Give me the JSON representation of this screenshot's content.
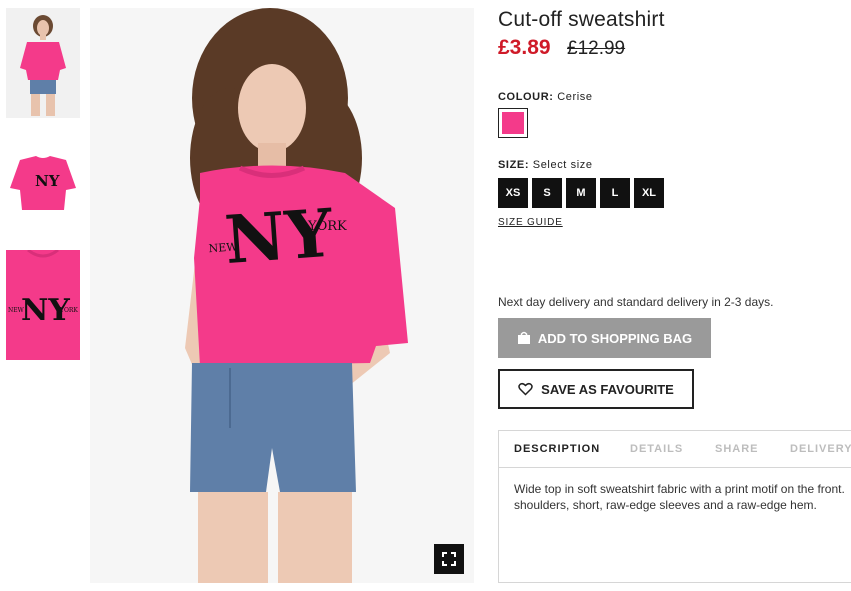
{
  "product": {
    "title": "Cut-off sweatshirt",
    "price_sale": "£3.89",
    "price_original": "£12.99"
  },
  "colour": {
    "label": "COLOUR:",
    "value": "Cerise",
    "swatch_color": "#f43a8a"
  },
  "size": {
    "label": "SIZE:",
    "value": "Select size",
    "options": [
      "XS",
      "S",
      "M",
      "L",
      "XL"
    ],
    "guide_label": "SIZE GUIDE"
  },
  "delivery_text": "Next day delivery and standard delivery in 2-3 days.",
  "buttons": {
    "add_to_bag": "ADD TO SHOPPING BAG",
    "save_favourite": "SAVE AS FAVOURITE"
  },
  "tabs": [
    "DESCRIPTION",
    "DETAILS",
    "SHARE",
    "DELIVERY"
  ],
  "description": "Wide top in soft sweatshirt fabric with a print motif on the front. shoulders, short, raw-edge sleeves and a raw-edge hem.",
  "print_text": {
    "big": "NY",
    "left": "NEW",
    "right": "YORK"
  },
  "icons": {
    "add_to_bag": "shopping-bag-icon",
    "save_favourite": "heart-icon",
    "fullscreen": "expand-icon"
  },
  "colors": {
    "price_sale": "#cf1a28",
    "shirt": "#f43a8a",
    "add_to_bag_bg": "#9a9a9a"
  }
}
